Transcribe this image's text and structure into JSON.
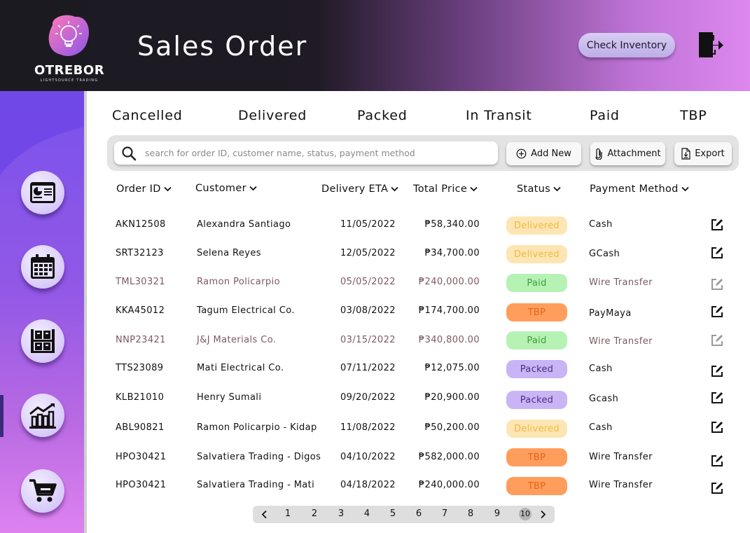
{
  "header": {
    "title": "Sales Order",
    "logo_name": "OTREBOR",
    "logo_tagline": "LIGHTSOURCE TRADING",
    "check_inventory_label": "Check Inventory"
  },
  "tabs": [
    {
      "label": "Cancelled"
    },
    {
      "label": "Delivered"
    },
    {
      "label": "Packed"
    },
    {
      "label": "In Transit"
    },
    {
      "label": "Paid"
    },
    {
      "label": "TBP"
    }
  ],
  "search": {
    "placeholder": "search for order ID, customer name, status, payment method",
    "value": ""
  },
  "toolbar": {
    "add_new_label": "Add New",
    "attachment_label": "Attachment",
    "export_label": "Export"
  },
  "columns": {
    "order_id": "Order ID",
    "customer": "Customer",
    "delivery_eta": "Delivery ETA",
    "total_price": "Total Price",
    "status": "Status",
    "payment_method": "Payment Method"
  },
  "rows": [
    {
      "order_id": "AKN12508",
      "customer": "Alexandra Santiago",
      "eta": "11/05/2022",
      "price": "₱58,340.00",
      "status": "Delivered",
      "payment": "Cash",
      "muted": false
    },
    {
      "order_id": "SRT32123",
      "customer": "Selena Reyes",
      "eta": "12/05/2022",
      "price": "₱34,700.00",
      "status": "Delivered",
      "payment": "GCash",
      "muted": false
    },
    {
      "order_id": "TML30321",
      "customer": "Ramon Policarpio",
      "eta": "05/05/2022",
      "price": "₱240,000.00",
      "status": "Paid",
      "payment": "Wire Transfer",
      "muted": true
    },
    {
      "order_id": "KKA45012",
      "customer": "Tagum Electrical Co.",
      "eta": "03/08/2022",
      "price": "₱174,700.00",
      "status": "TBP",
      "payment": "PayMaya",
      "muted": false
    },
    {
      "order_id": "NNP23421",
      "customer": "J&J Materials Co.",
      "eta": "03/15/2022",
      "price": "₱340,800.00",
      "status": "Paid",
      "payment": "Wire Transfer",
      "muted": true
    },
    {
      "order_id": "TTS23089",
      "customer": "Mati Electrical Co.",
      "eta": "07/11/2022",
      "price": "₱12,075.00",
      "status": "Packed",
      "payment": "Cash",
      "muted": false
    },
    {
      "order_id": "KLB21010",
      "customer": "Henry Sumali",
      "eta": "09/20/2022",
      "price": "₱20,900.00",
      "status": "Packed",
      "payment": "Gcash",
      "muted": false
    },
    {
      "order_id": "ABL90821",
      "customer": "Ramon Policarpio - Kidap",
      "eta": "11/08/2022",
      "price": "₱50,200.00",
      "status": "Delivered",
      "payment": "Cash",
      "muted": false
    },
    {
      "order_id": "HPO30421",
      "customer": "Salvatiera Trading - Digos",
      "eta": "04/10/2022",
      "price": "₱582,000.00",
      "status": "TBP",
      "payment": "Wire Transfer",
      "muted": false
    },
    {
      "order_id": "HPO30421",
      "customer": "Salvatiera Trading - Mati",
      "eta": "04/18/2022",
      "price": "₱240,000.00",
      "status": "TBP",
      "payment": "Wire Transfer",
      "muted": false
    }
  ],
  "status_colors": {
    "Delivered": {
      "bg": "#fde6b4",
      "fg": "#f2b93a"
    },
    "Paid": {
      "bg": "#b6f2b4",
      "fg": "#3f9d3c"
    },
    "TBP": {
      "bg": "#ff9e5c",
      "fg": "#e8621e"
    },
    "Packed": {
      "bg": "#c9b4f5",
      "fg": "#4a2f86"
    }
  },
  "pagination": {
    "pages": [
      "1",
      "2",
      "3",
      "4",
      "5",
      "6",
      "7",
      "8",
      "9",
      "10"
    ],
    "current": "10"
  },
  "sidebar": {
    "items": [
      {
        "icon": "dashboard-icon"
      },
      {
        "icon": "calendar-icon"
      },
      {
        "icon": "warehouse-shelves-icon"
      },
      {
        "icon": "analytics-chart-icon"
      },
      {
        "icon": "shopping-cart-icon"
      }
    ]
  }
}
